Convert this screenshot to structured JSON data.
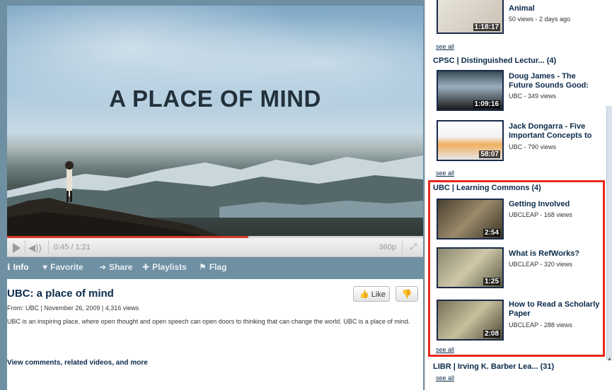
{
  "video": {
    "overlay_title": "A PLACE OF MIND",
    "time": "0:45 / 1:21",
    "quality": "360p",
    "progress": 0.58
  },
  "tabs": [
    {
      "label": "Info",
      "icon": "info-icon"
    },
    {
      "label": "Favorite",
      "icon": "heart-icon"
    },
    {
      "label": "Share",
      "icon": "arrow-icon"
    },
    {
      "label": "Playlists",
      "icon": "plus-icon"
    },
    {
      "label": "Flag",
      "icon": "flag-icon"
    }
  ],
  "info": {
    "title": "UBC: a place of mind",
    "meta": "From: UBC | November 26, 2009  | 4,316 views",
    "description": "UBC is an inspiring place, where open thought and open speech can open doors to thinking that can change the world. UBC is a place of mind.",
    "like_label": "Like",
    "more_link": "View comments, related videos, and more"
  },
  "sidebar": {
    "top_item": {
      "title": "Animal",
      "meta": "50 views - 2 days ago",
      "duration": "1:18:17"
    },
    "sections": [
      {
        "title": "CPSC | Distinguished Lectur... (4)",
        "items": [
          {
            "title": "Doug James - The Future Sounds Good:",
            "meta": "UBC - 349 views",
            "duration": "1:09:16"
          },
          {
            "title": "Jack Dongarra - Five Important Concepts to",
            "meta": "UBC - 790 views",
            "duration": "58:07"
          }
        ]
      },
      {
        "title": "UBC | Learning Commons (4)",
        "items": [
          {
            "title": "Getting Involved",
            "meta": "UBCLEAP - 168 views",
            "duration": "2:54"
          },
          {
            "title": "What is RefWorks?",
            "meta": "UBCLEAP - 320 views",
            "duration": "1:25"
          },
          {
            "title": "How to Read a Scholarly Paper",
            "meta": "UBCLEAP - 288 views",
            "duration": "2:08"
          }
        ]
      },
      {
        "title": "LIBR | Irving K. Barber Lea... (31)",
        "items": []
      }
    ],
    "see_all": "see all"
  },
  "colors": {
    "highlight": "#e8281e",
    "progress": "#d23b2c",
    "panel": "#6f8fa3",
    "title": "#0a2a4a"
  }
}
